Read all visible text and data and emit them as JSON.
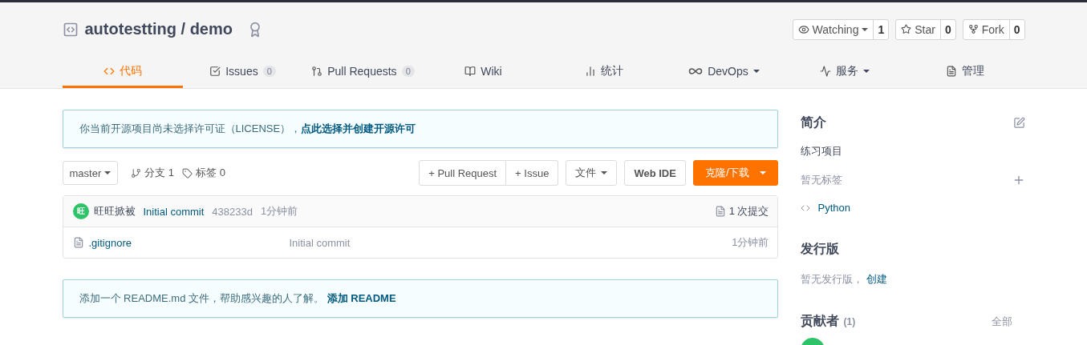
{
  "repo": {
    "owner": "autotestting",
    "separator": "/",
    "name": "demo"
  },
  "actions": [
    {
      "label": "Watching",
      "count": "1",
      "kind": "watch",
      "dropdown": true
    },
    {
      "label": "Star",
      "count": "0",
      "kind": "star",
      "dropdown": false
    },
    {
      "label": "Fork",
      "count": "0",
      "kind": "fork",
      "dropdown": false
    }
  ],
  "tabs": [
    {
      "label": "代码",
      "kind": "code",
      "selected": true
    },
    {
      "label": "Issues",
      "kind": "issues",
      "count": "0",
      "selected": false
    },
    {
      "label": "Pull Requests",
      "kind": "pr",
      "count": "0",
      "selected": false
    },
    {
      "label": "Wiki",
      "kind": "wiki",
      "selected": false
    },
    {
      "label": "统计",
      "kind": "stats",
      "selected": false
    },
    {
      "label": "DevOps",
      "kind": "devops",
      "dropdown": true,
      "selected": false
    },
    {
      "label": "服务",
      "kind": "service",
      "dropdown": true,
      "selected": false
    },
    {
      "label": "管理",
      "kind": "manage",
      "selected": false
    }
  ],
  "license_notice": {
    "text": "你当前开源项目尚未选择许可证（LICENSE），",
    "link": "点此选择并创建开源许可"
  },
  "toolbar": {
    "branch": "master",
    "branches": "分支 1",
    "tags": "标签 0",
    "buttons": [
      {
        "label": "+ Pull Request",
        "kind": "group"
      },
      {
        "label": "+ Issue",
        "kind": "group"
      },
      {
        "label": "文件",
        "kind": "dropdown"
      },
      {
        "label": "Web IDE",
        "kind": "plain"
      },
      {
        "label": "克隆/下载",
        "kind": "primary"
      }
    ]
  },
  "commit": {
    "avatar": "旺",
    "author": "旺旺掀被",
    "message": "Initial commit",
    "hash": "438233d",
    "time": "1分钟前",
    "commits": "1 次提交"
  },
  "files": [
    {
      "name": ".gitignore",
      "message": "Initial commit",
      "time": "1分钟前"
    }
  ],
  "readme_notice": {
    "text": "添加一个 README.md 文件，帮助感兴趣的人了解。",
    "link": "添加 README"
  },
  "sidebar": {
    "intro_title": "简介",
    "description": "练习项目",
    "no_tags": "暂无标签",
    "language": "Python",
    "releases_title": "发行版",
    "no_releases": "暂无发行版，",
    "create_link": "创建",
    "contributors_title": "贡献者",
    "contributors_count": "(1)",
    "all_link": "全部"
  }
}
